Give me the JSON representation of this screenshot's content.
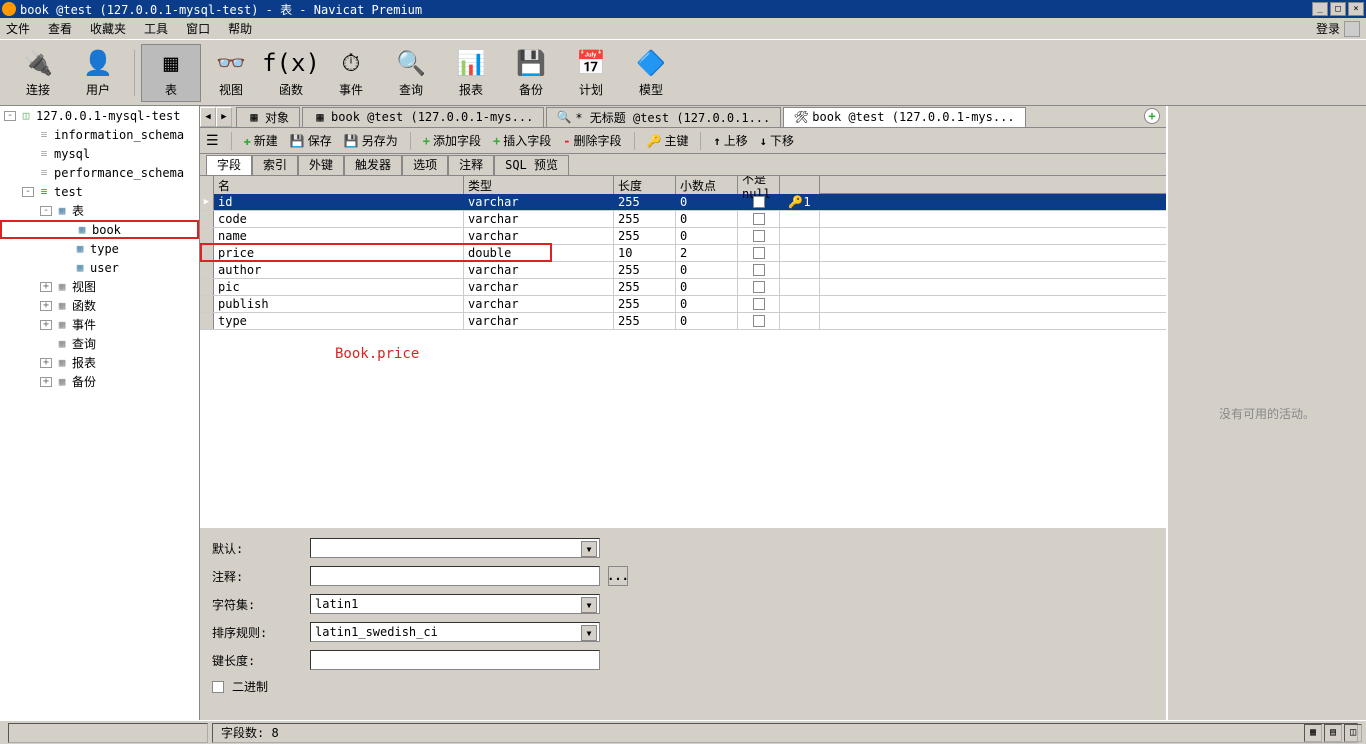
{
  "titlebar": {
    "title": "book @test (127.0.0.1-mysql-test) - 表 - Navicat Premium",
    "min": "_",
    "max": "□",
    "close": "×"
  },
  "menu": {
    "items": [
      "文件",
      "查看",
      "收藏夹",
      "工具",
      "窗口",
      "帮助"
    ],
    "login": "登录"
  },
  "toolbar": {
    "items": [
      {
        "label": "连接",
        "icon": "🔌"
      },
      {
        "label": "用户",
        "icon": "👤"
      },
      {
        "label": "表",
        "icon": "▦",
        "sel": true
      },
      {
        "label": "视图",
        "icon": "👓"
      },
      {
        "label": "函数",
        "icon": "f(x)"
      },
      {
        "label": "事件",
        "icon": "⏱"
      },
      {
        "label": "查询",
        "icon": "🔍"
      },
      {
        "label": "报表",
        "icon": "📊"
      },
      {
        "label": "备份",
        "icon": "💾"
      },
      {
        "label": "计划",
        "icon": "📅"
      },
      {
        "label": "模型",
        "icon": "🔷"
      }
    ]
  },
  "tree": [
    {
      "ind": 0,
      "exp": "-",
      "ico": "connection",
      "label": "127.0.0.1-mysql-test"
    },
    {
      "ind": 1,
      "ico": "db",
      "label": "information_schema"
    },
    {
      "ind": 1,
      "ico": "db",
      "label": "mysql"
    },
    {
      "ind": 1,
      "ico": "db",
      "label": "performance_schema"
    },
    {
      "ind": 1,
      "exp": "-",
      "ico": "db-active",
      "label": "test"
    },
    {
      "ind": 2,
      "exp": "-",
      "ico": "table",
      "label": "表"
    },
    {
      "ind": 3,
      "ico": "table",
      "label": "book",
      "red": true
    },
    {
      "ind": 3,
      "ico": "table",
      "label": "type"
    },
    {
      "ind": 3,
      "ico": "table",
      "label": "user"
    },
    {
      "ind": 2,
      "exp": "+",
      "ico": "folder",
      "label": "视图"
    },
    {
      "ind": 2,
      "exp": "+",
      "ico": "folder",
      "label": "函数"
    },
    {
      "ind": 2,
      "exp": "+",
      "ico": "folder",
      "label": "事件"
    },
    {
      "ind": 2,
      "ico": "folder",
      "label": "查询"
    },
    {
      "ind": 2,
      "exp": "+",
      "ico": "folder",
      "label": "报表"
    },
    {
      "ind": 2,
      "exp": "+",
      "ico": "folder",
      "label": "备份"
    }
  ],
  "view_icons": {
    "connection": "◫",
    "db": "≡",
    "db-active": "≡",
    "table": "▦",
    "folder": "▦"
  },
  "tabs": [
    {
      "label": "对象",
      "icon": "▦"
    },
    {
      "label": "book @test (127.0.0.1-mys...",
      "icon": "▦"
    },
    {
      "label": "* 无标题 @test (127.0.0.1...",
      "icon": "🔍"
    },
    {
      "label": "book @test (127.0.0.1-mys...",
      "icon": "🛠",
      "active": true
    }
  ],
  "actions": [
    {
      "label": "新建",
      "icon": "✚",
      "color": "#3a3"
    },
    {
      "label": "保存",
      "icon": "💾"
    },
    {
      "label": "另存为",
      "icon": "💾"
    },
    {
      "label": "添加字段",
      "icon": "+",
      "color": "#3a3"
    },
    {
      "label": "插入字段",
      "icon": "+",
      "color": "#3a3"
    },
    {
      "label": "删除字段",
      "icon": "-",
      "color": "#d22"
    },
    {
      "label": "主键",
      "icon": "🔑",
      "color": "#e8a000"
    },
    {
      "label": "上移",
      "icon": "↑"
    },
    {
      "label": "下移",
      "icon": "↓"
    }
  ],
  "sub_tabs": [
    "字段",
    "索引",
    "外键",
    "触发器",
    "选项",
    "注释",
    "SQL 预览"
  ],
  "grid": {
    "headers": [
      "名",
      "类型",
      "长度",
      "小数点",
      "不是 null",
      ""
    ],
    "rows": [
      {
        "name": "id",
        "type": "varchar",
        "len": "255",
        "dec": "0",
        "null": true,
        "key": "1",
        "sel": true
      },
      {
        "name": "code",
        "type": "varchar",
        "len": "255",
        "dec": "0",
        "null": false
      },
      {
        "name": "name",
        "type": "varchar",
        "len": "255",
        "dec": "0",
        "null": false
      },
      {
        "name": "price",
        "type": "double",
        "len": "10",
        "dec": "2",
        "null": false,
        "red": true
      },
      {
        "name": "author",
        "type": "varchar",
        "len": "255",
        "dec": "0",
        "null": false
      },
      {
        "name": "pic",
        "type": "varchar",
        "len": "255",
        "dec": "0",
        "null": false
      },
      {
        "name": "publish",
        "type": "varchar",
        "len": "255",
        "dec": "0",
        "null": false
      },
      {
        "name": "type",
        "type": "varchar",
        "len": "255",
        "dec": "0",
        "null": false
      }
    ]
  },
  "annotation": "Book.price",
  "form": {
    "default_label": "默认:",
    "comment_label": "注释:",
    "charset_label": "字符集:",
    "collation_label": "排序规则:",
    "keylen_label": "键长度:",
    "binary_label": "二进制",
    "default_value": "",
    "comment_value": "",
    "charset_value": "latin1",
    "collation_value": "latin1_swedish_ci",
    "keylen_value": ""
  },
  "right_panel": {
    "text": "没有可用的活动。"
  },
  "statusbar": {
    "fields_label": "字段数: 8"
  }
}
